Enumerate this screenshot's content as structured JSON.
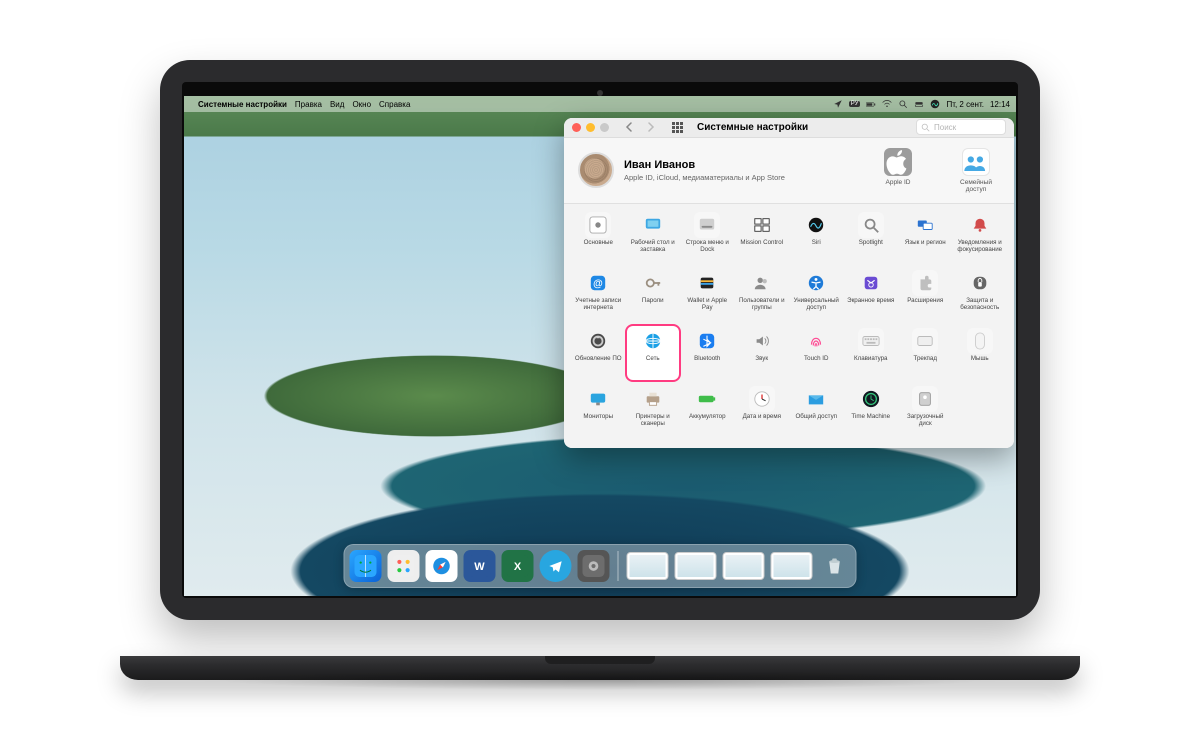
{
  "menubar": {
    "app": "Системные настройки",
    "items": [
      "Правка",
      "Вид",
      "Окно",
      "Справка"
    ],
    "date": "Пт, 2 сент.",
    "time": "12:14",
    "input_lang": "РУ"
  },
  "window": {
    "title": "Системные настройки",
    "search_placeholder": "Поиск",
    "user": {
      "name": "Иван Иванов",
      "subtitle": "Apple ID, iCloud, медиаматериалы и App Store"
    },
    "header_icons": [
      {
        "name": "apple-id",
        "label": "Apple ID"
      },
      {
        "name": "family-sharing",
        "label": "Семейный доступ"
      }
    ],
    "panes": [
      [
        {
          "name": "general",
          "label": "Основные"
        },
        {
          "name": "desktop",
          "label": "Рабочий стол и заставка"
        },
        {
          "name": "dock",
          "label": "Строка меню и Dock"
        },
        {
          "name": "mission",
          "label": "Mission Control"
        },
        {
          "name": "siri",
          "label": "Siri"
        },
        {
          "name": "spotlight",
          "label": "Spotlight"
        },
        {
          "name": "language",
          "label": "Язык и регион"
        },
        {
          "name": "notifications",
          "label": "Уведомления и фокусирование"
        }
      ],
      [
        {
          "name": "internet",
          "label": "Учетные записи интернета"
        },
        {
          "name": "passwords",
          "label": "Пароли"
        },
        {
          "name": "wallet",
          "label": "Wallet и Apple Pay"
        },
        {
          "name": "users",
          "label": "Пользователи и группы"
        },
        {
          "name": "accessibility",
          "label": "Универсальный доступ"
        },
        {
          "name": "screentime",
          "label": "Экранное время"
        },
        {
          "name": "extensions",
          "label": "Расширения"
        },
        {
          "name": "security",
          "label": "Защита и безопасность"
        }
      ],
      [
        {
          "name": "softwareupdate",
          "label": "Обновление ПО"
        },
        {
          "name": "network",
          "label": "Сеть",
          "highlight": true
        },
        {
          "name": "bluetooth",
          "label": "Bluetooth"
        },
        {
          "name": "sound",
          "label": "Звук"
        },
        {
          "name": "touchid",
          "label": "Touch ID"
        },
        {
          "name": "keyboard",
          "label": "Клавиатура"
        },
        {
          "name": "trackpad",
          "label": "Трекпад"
        },
        {
          "name": "mouse",
          "label": "Мышь"
        }
      ],
      [
        {
          "name": "displays",
          "label": "Мониторы"
        },
        {
          "name": "printers",
          "label": "Принтеры и сканеры"
        },
        {
          "name": "battery",
          "label": "Аккумулятор"
        },
        {
          "name": "datetime",
          "label": "Дата и время"
        },
        {
          "name": "sharing",
          "label": "Общий доступ"
        },
        {
          "name": "timemachine",
          "label": "Time Machine"
        },
        {
          "name": "startupdisk",
          "label": "Загрузочный диск"
        }
      ]
    ]
  },
  "dock": {
    "left": [
      {
        "name": "finder",
        "class": "finder-icon"
      },
      {
        "name": "launchpad",
        "class": "launchpad-icon"
      },
      {
        "name": "safari",
        "class": "safari-icon"
      },
      {
        "name": "word",
        "class": "word-icon",
        "glyph": "W"
      },
      {
        "name": "excel",
        "class": "excel-icon",
        "glyph": "X"
      },
      {
        "name": "telegram",
        "class": "telegram-icon"
      },
      {
        "name": "system-preferences",
        "class": "sysprefs-icon"
      }
    ],
    "minimized_count": 4,
    "trash": {
      "name": "trash"
    }
  },
  "icons": {
    "general": "#8f8f8f",
    "desktop": "#57b4e9",
    "dock": "#dadada",
    "mission": "#2f2f2f",
    "siri": "#19a8e0",
    "spotlight": "#d8d8d8",
    "language": "#2c73d0",
    "notifications": "#d24b4b",
    "internet": "#1e88e5",
    "passwords": "#9b8f80",
    "wallet": "#222",
    "users": "#9d9d9d",
    "accessibility": "#1f7bd8",
    "screentime": "#6a4bd3",
    "extensions": "#b8b8b8",
    "security": "#666",
    "softwareupdate": "#4a4a4a",
    "network": "#1aa0e6",
    "bluetooth": "#1a7df0",
    "sound": "#a8a8a8",
    "touchid": "#ff4a93",
    "keyboard": "#d7d7d7",
    "trackpad": "#cfcfcf",
    "mouse": "#e3e3e3",
    "displays": "#2aa4df",
    "printers": "#b5a08a",
    "battery": "#3fbd4a",
    "datetime": "#e3e3e3",
    "sharing": "#2b9de0",
    "timemachine": "#101820",
    "startupdisk": "#b8b8b8"
  }
}
